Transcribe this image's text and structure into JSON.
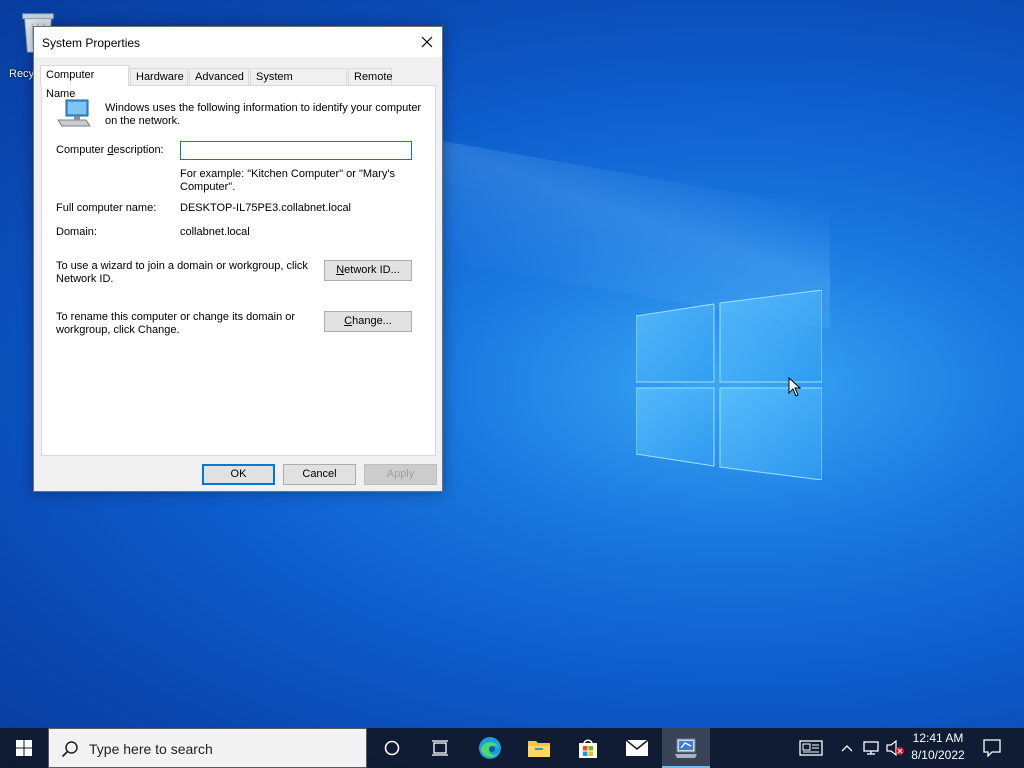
{
  "desktop": {
    "recycle_bin_label": "Recy"
  },
  "dialog": {
    "title": "System Properties",
    "tabs": [
      {
        "label": "Computer Name",
        "active": true
      },
      {
        "label": "Hardware",
        "active": false
      },
      {
        "label": "Advanced",
        "active": false
      },
      {
        "label": "System Protection",
        "active": false
      },
      {
        "label": "Remote",
        "active": false
      }
    ],
    "info_text": "Windows uses the following information to identify your computer on the network.",
    "description_label": "Computer description:",
    "description_value": "",
    "example_text": "For example: \"Kitchen Computer\" or \"Mary's Computer\".",
    "full_name_label": "Full computer name:",
    "full_name_value": "DESKTOP-IL75PE3.collabnet.local",
    "domain_label": "Domain:",
    "domain_value": "collabnet.local",
    "network_id_text": "To use a wizard to join a domain or workgroup, click Network ID.",
    "network_id_button": "Network ID...",
    "change_text": "To rename this computer or change its domain or workgroup, click Change.",
    "change_button": "Change...",
    "ok_button": "OK",
    "cancel_button": "Cancel",
    "apply_button": "Apply"
  },
  "taskbar": {
    "search_placeholder": "Type here to search",
    "time": "12:41 AM",
    "date": "8/10/2022",
    "icons": [
      "start-icon",
      "search-icon",
      "cortana-icon",
      "task-view-icon",
      "edge-icon",
      "file-explorer-icon",
      "store-icon",
      "mail-icon",
      "system-properties-icon",
      "news-icon",
      "chevron-up-icon",
      "network-icon",
      "volume-muted-icon",
      "notification-icon"
    ]
  },
  "colors": {
    "accent": "#0078d7",
    "taskbar": "#101828",
    "desktop": "#0d5ccc"
  }
}
